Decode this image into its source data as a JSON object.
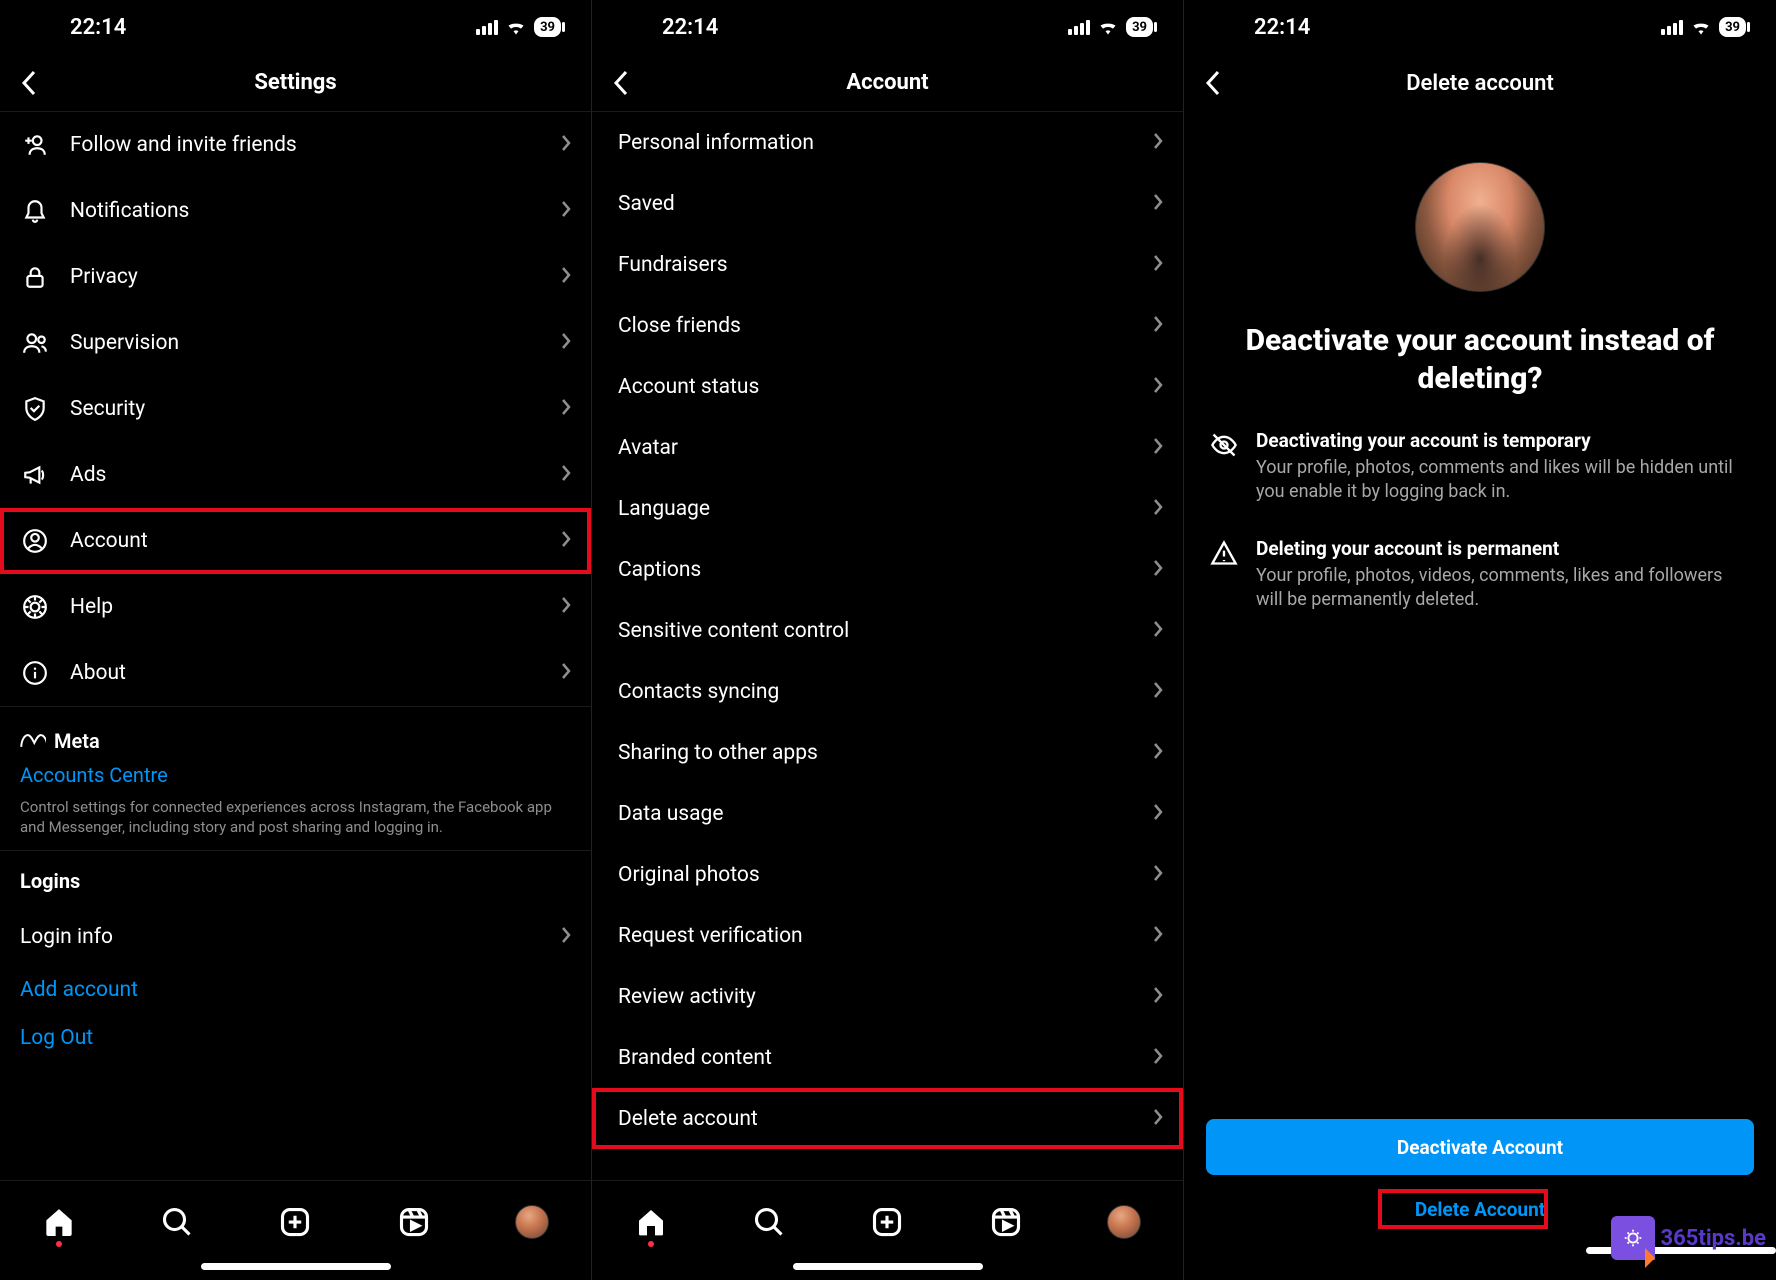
{
  "status": {
    "time": "22:14",
    "battery": "39"
  },
  "screen1": {
    "title": "Settings",
    "items": [
      {
        "label": "Follow and invite friends"
      },
      {
        "label": "Notifications"
      },
      {
        "label": "Privacy"
      },
      {
        "label": "Supervision"
      },
      {
        "label": "Security"
      },
      {
        "label": "Ads"
      },
      {
        "label": "Account",
        "highlight": true
      },
      {
        "label": "Help"
      },
      {
        "label": "About"
      }
    ],
    "meta_brand": "Meta",
    "accounts_centre": "Accounts Centre",
    "accounts_desc": "Control settings for connected experiences across Instagram, the Facebook app and Messenger, including story and post sharing and logging in.",
    "logins_title": "Logins",
    "login_info": "Login info",
    "add_account": "Add account",
    "log_out": "Log Out"
  },
  "screen2": {
    "title": "Account",
    "items": [
      {
        "label": "Personal information"
      },
      {
        "label": "Saved"
      },
      {
        "label": "Fundraisers"
      },
      {
        "label": "Close friends"
      },
      {
        "label": "Account status"
      },
      {
        "label": "Avatar"
      },
      {
        "label": "Language"
      },
      {
        "label": "Captions"
      },
      {
        "label": "Sensitive content control"
      },
      {
        "label": "Contacts syncing"
      },
      {
        "label": "Sharing to other apps"
      },
      {
        "label": "Data usage"
      },
      {
        "label": "Original photos"
      },
      {
        "label": "Request verification"
      },
      {
        "label": "Review activity"
      },
      {
        "label": "Branded content"
      },
      {
        "label": "Delete account",
        "highlight": true
      }
    ]
  },
  "screen3": {
    "title": "Delete account",
    "heading": "Deactivate your account instead of deleting?",
    "block1_title": "Deactivating your account is temporary",
    "block1_sub": "Your profile, photos, comments and likes will be hidden until you enable it by logging back in.",
    "block2_title": "Deleting your account is permanent",
    "block2_sub": "Your profile, photos, videos, comments, likes and followers will be permanently deleted.",
    "deactivate_btn": "Deactivate Account",
    "delete_btn": "Delete Account"
  },
  "watermark": "365tips.be"
}
